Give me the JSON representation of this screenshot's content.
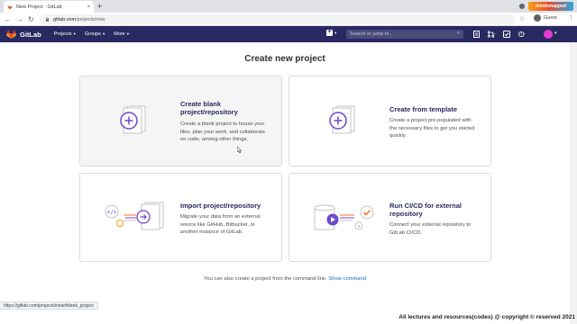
{
  "browser": {
    "tab_title": "New Project · GitLab",
    "tab_close": "×",
    "new_tab": "+",
    "url_domain": "gitlab.com",
    "url_path": "/projects/new",
    "profile_label": "Guest",
    "brand_label": "mindsmapped",
    "status_url": "https://gitlab.com/projects/new#blank_project"
  },
  "nav": {
    "brand": "GitLab",
    "menu": [
      {
        "label": "Projects"
      },
      {
        "label": "Groups"
      },
      {
        "label": "More"
      }
    ],
    "search_placeholder": "Search or jump to..."
  },
  "page": {
    "title": "Create new project",
    "cards": [
      {
        "title_lines": [
          "Create blank",
          "project/repository"
        ],
        "desc_lines": [
          "Create a blank project to house your",
          "files, plan your work, and collaborate",
          "on code, among other things."
        ]
      },
      {
        "title_lines": [
          "Create from template"
        ],
        "desc_lines": [
          "Create a project pre-populated with",
          "the necessary files to get you started",
          "quickly."
        ]
      },
      {
        "title_lines": [
          "Import project/repository"
        ],
        "desc_lines": [
          "Migrate your data from an external",
          "source like GitHub, Bitbucket, or",
          "another instance of GitLab."
        ]
      },
      {
        "title_lines": [
          "Run CI/CD for external",
          "repository"
        ],
        "desc_lines": [
          "Connect your external repository to",
          "GitLab CI/CD."
        ]
      }
    ],
    "footer_text": "You can also create a project from the command line.",
    "footer_link": "Show command"
  },
  "overlay": {
    "copyright": "All lectures and resources(codes) @ copyright © reserved 2021"
  },
  "colors": {
    "navbar": "#292961",
    "accent": "#6e49cb",
    "link": "#1068bf"
  }
}
